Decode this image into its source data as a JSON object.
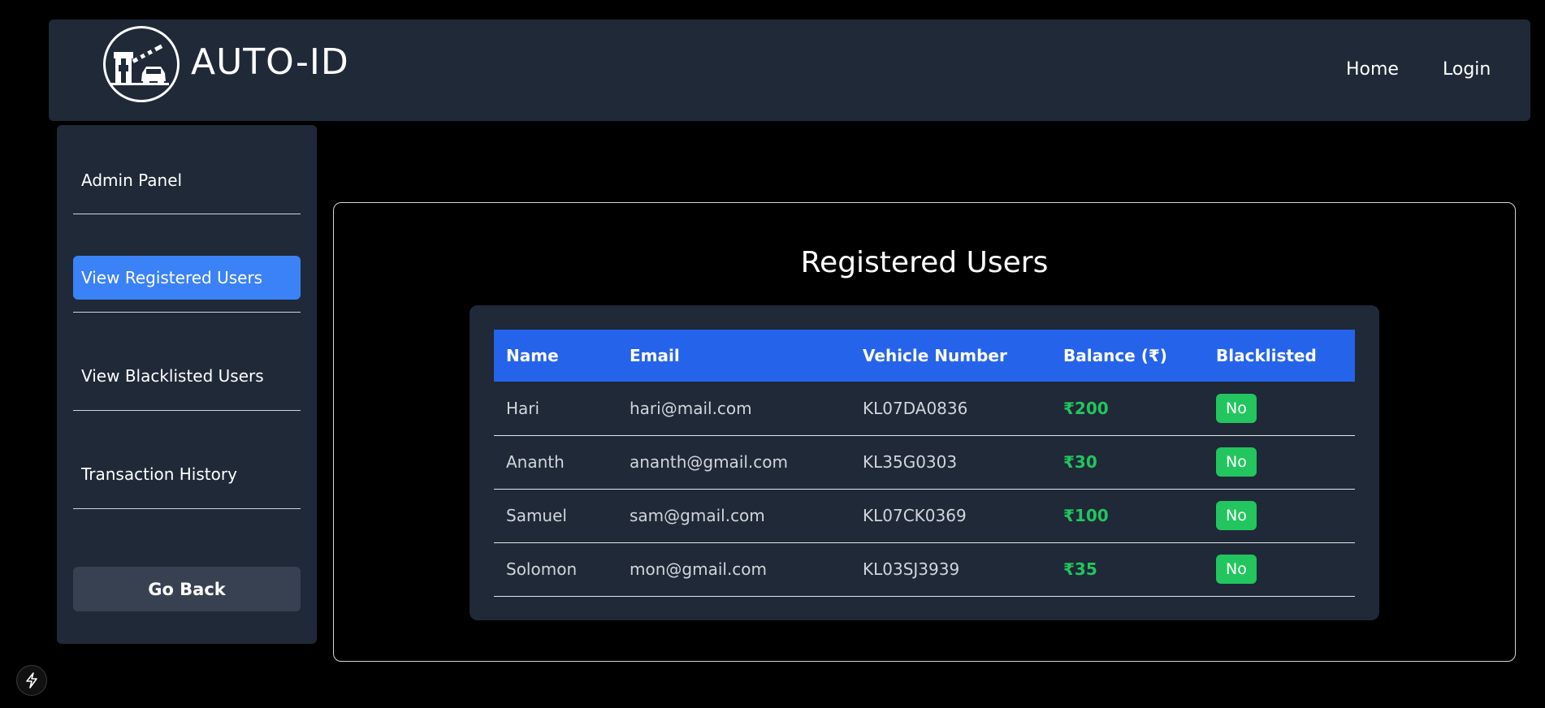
{
  "navbar": {
    "brand": "AUTO-ID",
    "links": {
      "home": "Home",
      "login": "Login"
    }
  },
  "sidebar": {
    "items": [
      {
        "label": "Admin Panel",
        "active": false
      },
      {
        "label": "View Registered Users",
        "active": true
      },
      {
        "label": "View Blacklisted Users",
        "active": false
      },
      {
        "label": "Transaction History",
        "active": false
      }
    ],
    "go_back": "Go Back"
  },
  "main": {
    "title": "Registered Users",
    "columns": [
      "Name",
      "Email",
      "Vehicle Number",
      "Balance (₹)",
      "Blacklisted"
    ],
    "rows": [
      {
        "name": "Hari",
        "email": "hari@mail.com",
        "vehicle": "KL07DA0836",
        "balance": "₹200",
        "blacklisted": "No"
      },
      {
        "name": "Ananth",
        "email": "ananth@gmail.com",
        "vehicle": "KL35G0303",
        "balance": "₹30",
        "blacklisted": "No"
      },
      {
        "name": "Samuel",
        "email": "sam@gmail.com",
        "vehicle": "KL07CK0369",
        "balance": "₹100",
        "blacklisted": "No"
      },
      {
        "name": "Solomon",
        "email": "mon@gmail.com",
        "vehicle": "KL03SJ3939",
        "balance": "₹35",
        "blacklisted": "No"
      }
    ]
  },
  "icons": {
    "logo": "toll-gate-car-icon",
    "corner": "lightning-bolt-icon"
  },
  "colors": {
    "panel": "#1f2937",
    "accent": "#3b82f6",
    "table_header": "#2563eb",
    "positive": "#22c55e"
  }
}
